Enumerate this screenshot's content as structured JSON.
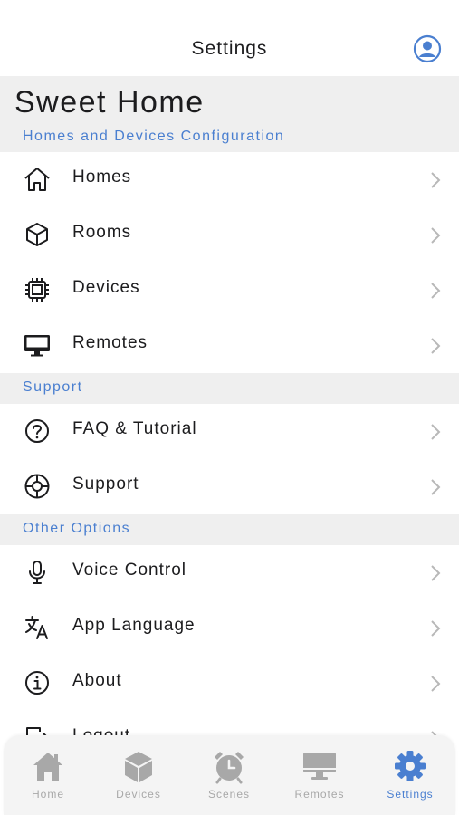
{
  "header": {
    "title": "Settings",
    "profile_icon": "user-circle-icon"
  },
  "home": {
    "name": "Sweet Home",
    "subtitle": "Homes and Devices Configuration"
  },
  "sections": {
    "config_items": [
      {
        "label": "Homes",
        "icon": "house-icon"
      },
      {
        "label": "Rooms",
        "icon": "cube-icon"
      },
      {
        "label": "Devices",
        "icon": "chip-icon"
      },
      {
        "label": "Remotes",
        "icon": "monitor-icon"
      }
    ],
    "support_title": "Support",
    "support_items": [
      {
        "label": "FAQ & Tutorial",
        "icon": "question-circle-icon"
      },
      {
        "label": "Support",
        "icon": "lifebuoy-icon"
      }
    ],
    "other_title": "Other Options",
    "other_items": [
      {
        "label": "Voice Control",
        "icon": "microphone-icon"
      },
      {
        "label": "App Language",
        "icon": "translate-icon"
      },
      {
        "label": "About",
        "icon": "info-circle-icon"
      },
      {
        "label": "Logout",
        "icon": "logout-icon"
      }
    ]
  },
  "tabbar": {
    "tabs": [
      {
        "label": "Home",
        "icon": "house-icon"
      },
      {
        "label": "Devices",
        "icon": "cube-icon"
      },
      {
        "label": "Scenes",
        "icon": "alarm-clock-icon"
      },
      {
        "label": "Remotes",
        "icon": "monitor-icon"
      },
      {
        "label": "Settings",
        "icon": "gear-icon"
      }
    ],
    "active": "Settings"
  },
  "colors": {
    "accent": "#4a7fd0",
    "section_bg": "#efefef",
    "inactive_tab": "#a8a8a8",
    "text": "#1c1c1e"
  }
}
